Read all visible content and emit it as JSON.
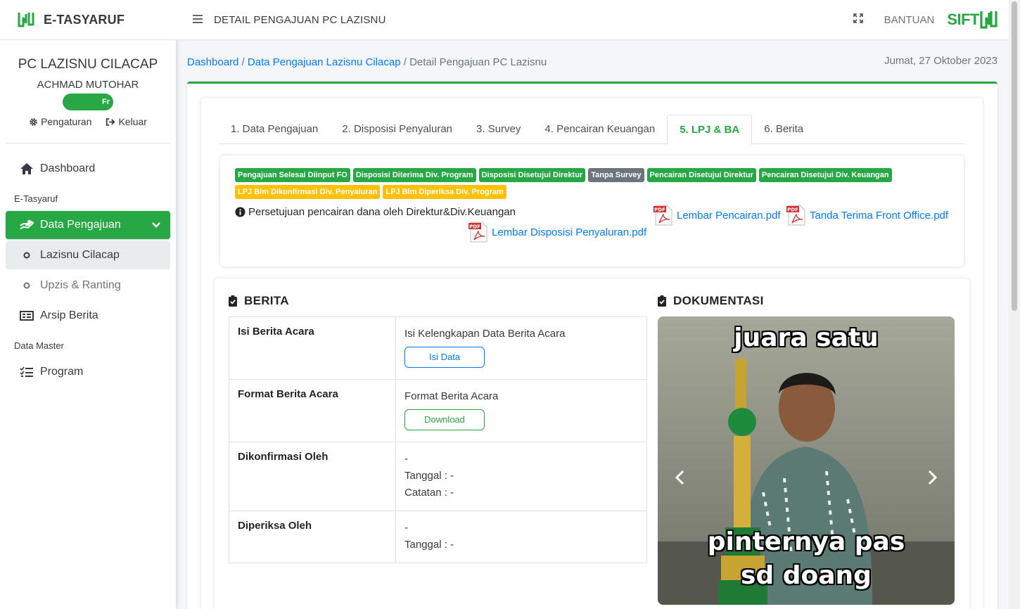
{
  "brand": {
    "name": "E-TASYARUF"
  },
  "user": {
    "org": "PC LAZISNU CILACAP",
    "name": "ACHMAD MUTOHAR",
    "badge": "Fr",
    "settings": "Pengaturan",
    "logout": "Keluar"
  },
  "nav": {
    "dashboard": "Dashboard",
    "header1": "E-Tasyaruf",
    "data_pengajuan": "Data Pengajuan",
    "lazisnu": "Lazisnu Cilacap",
    "upzis": "Upzis & Ranting",
    "arsip": "Arsip Berita",
    "header2": "Data Master",
    "program": "Program"
  },
  "topbar": {
    "title": "DETAIL PENGAJUAN PC LAZISNU",
    "help": "BANTUAN",
    "logo": "SIFT"
  },
  "breadcrumb": {
    "b1": "Dashboard",
    "sep": " / ",
    "b2": "Data Pengajuan Lazisnu Cilacap",
    "b3": "Detail Pengajuan PC Lazisnu"
  },
  "date": "Jumat, 27 Oktober 2023",
  "tabs": [
    "1. Data Pengajuan",
    "2. Disposisi Penyaluran",
    "3. Survey",
    "4. Pencairan Keuangan",
    "5. LPJ & BA",
    "6. Berita"
  ],
  "badges": [
    {
      "label": "Pengajuan Selesai Diinput FO",
      "color": "#28a745"
    },
    {
      "label": "Disposisi Diterima Div. Program",
      "color": "#28a745"
    },
    {
      "label": "Disposisi Disetujui Direktur",
      "color": "#28a745"
    },
    {
      "label": "Tanpa Survey",
      "color": "#6c757d"
    },
    {
      "label": "Pencairan Disetujui Direktur",
      "color": "#28a745"
    },
    {
      "label": "Pencairan Disetujui Div. Keuangan",
      "color": "#28a745"
    },
    {
      "label": "LPJ Blm Dikonfirmasi Div. Penyaluran",
      "color": "#ffc107"
    },
    {
      "label": "LPJ Blm Diperiksa Div. Program",
      "color": "#ffc107"
    }
  ],
  "status_info": "Persetujuan pencairan dana oleh Direktur&Div.Keuangan",
  "pdfs": {
    "pencairan": "Lembar Pencairan.pdf",
    "tanda_terima": "Tanda Terima Front Office.pdf",
    "disposisi": "Lembar Disposisi Penyaluran.pdf",
    "icon_label": "PDF"
  },
  "berita": {
    "title": "BERITA",
    "rows": [
      {
        "key": "Isi Berita Acara",
        "value": "Isi Kelengkapan Data Berita Acara",
        "button": "Isi Data"
      },
      {
        "key": "Format Berita Acara",
        "value": "Format Berita Acara",
        "button": "Download"
      },
      {
        "key": "Dikonfirmasi Oleh",
        "value": "-",
        "tanggal": "Tanggal : -",
        "catatan": "Catatan : -"
      },
      {
        "key": "Diperiksa Oleh",
        "value": "-",
        "tanggal": "Tanggal : -"
      }
    ]
  },
  "dokumentasi": {
    "title": "DOKUMENTASI",
    "caption_top": "juara satu",
    "caption_bottom1": "pinternya pas",
    "caption_bottom2": "sd doang"
  }
}
